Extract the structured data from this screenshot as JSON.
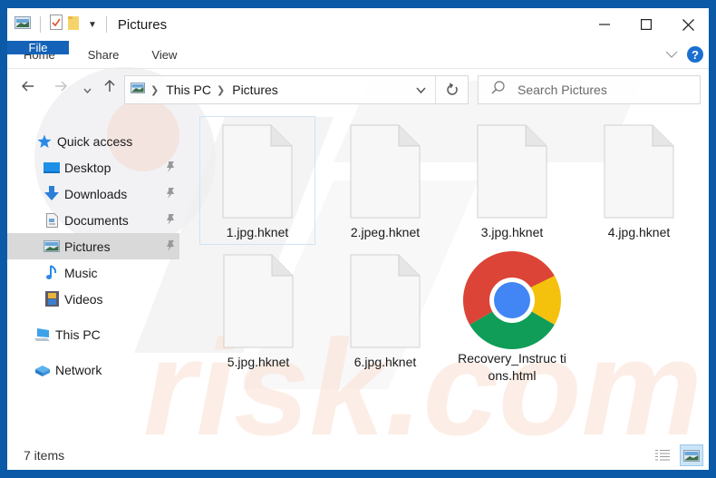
{
  "window": {
    "title": "Pictures",
    "controls": {
      "minimize": "minimize-icon",
      "maximize": "maximize-icon",
      "close": "close-icon"
    }
  },
  "ribbon": {
    "tabs": [
      {
        "label": "File",
        "active": true
      },
      {
        "label": "Home"
      },
      {
        "label": "Share"
      },
      {
        "label": "View"
      }
    ],
    "help_label": "?"
  },
  "navigation": {
    "breadcrumb": [
      "This PC",
      "Pictures"
    ],
    "search_placeholder": "Search Pictures"
  },
  "sidebar": {
    "quick_access": "Quick access",
    "items": [
      {
        "label": "Desktop",
        "icon": "desktop-icon",
        "pinned": true
      },
      {
        "label": "Downloads",
        "icon": "downloads-icon",
        "pinned": true
      },
      {
        "label": "Documents",
        "icon": "documents-icon",
        "pinned": true
      },
      {
        "label": "Pictures",
        "icon": "pictures-icon",
        "pinned": true,
        "selected": true
      },
      {
        "label": "Music",
        "icon": "music-icon"
      },
      {
        "label": "Videos",
        "icon": "videos-icon"
      }
    ],
    "this_pc": "This PC",
    "network": "Network"
  },
  "files": [
    {
      "name": "1.jpg.hknet",
      "type": "blank",
      "selected": true
    },
    {
      "name": "2.jpeg.hknet",
      "type": "blank"
    },
    {
      "name": "3.jpg.hknet",
      "type": "blank"
    },
    {
      "name": "4.jpg.hknet",
      "type": "blank"
    },
    {
      "name": "5.jpg.hknet",
      "type": "blank"
    },
    {
      "name": "6.jpg.hknet",
      "type": "blank"
    },
    {
      "name": "Recovery_Instructions.html",
      "display_name": "Recovery_Instruc tions.html",
      "type": "chrome-html"
    }
  ],
  "status": {
    "item_count": "7 items"
  },
  "colors": {
    "frame": "#0a5aa8",
    "file_tab": "#1463b8",
    "selection": "#d9d9d9",
    "chrome_red": "#db4437",
    "chrome_green": "#0f9d58",
    "chrome_yellow": "#f4b400",
    "chrome_blue": "#4285f4"
  }
}
